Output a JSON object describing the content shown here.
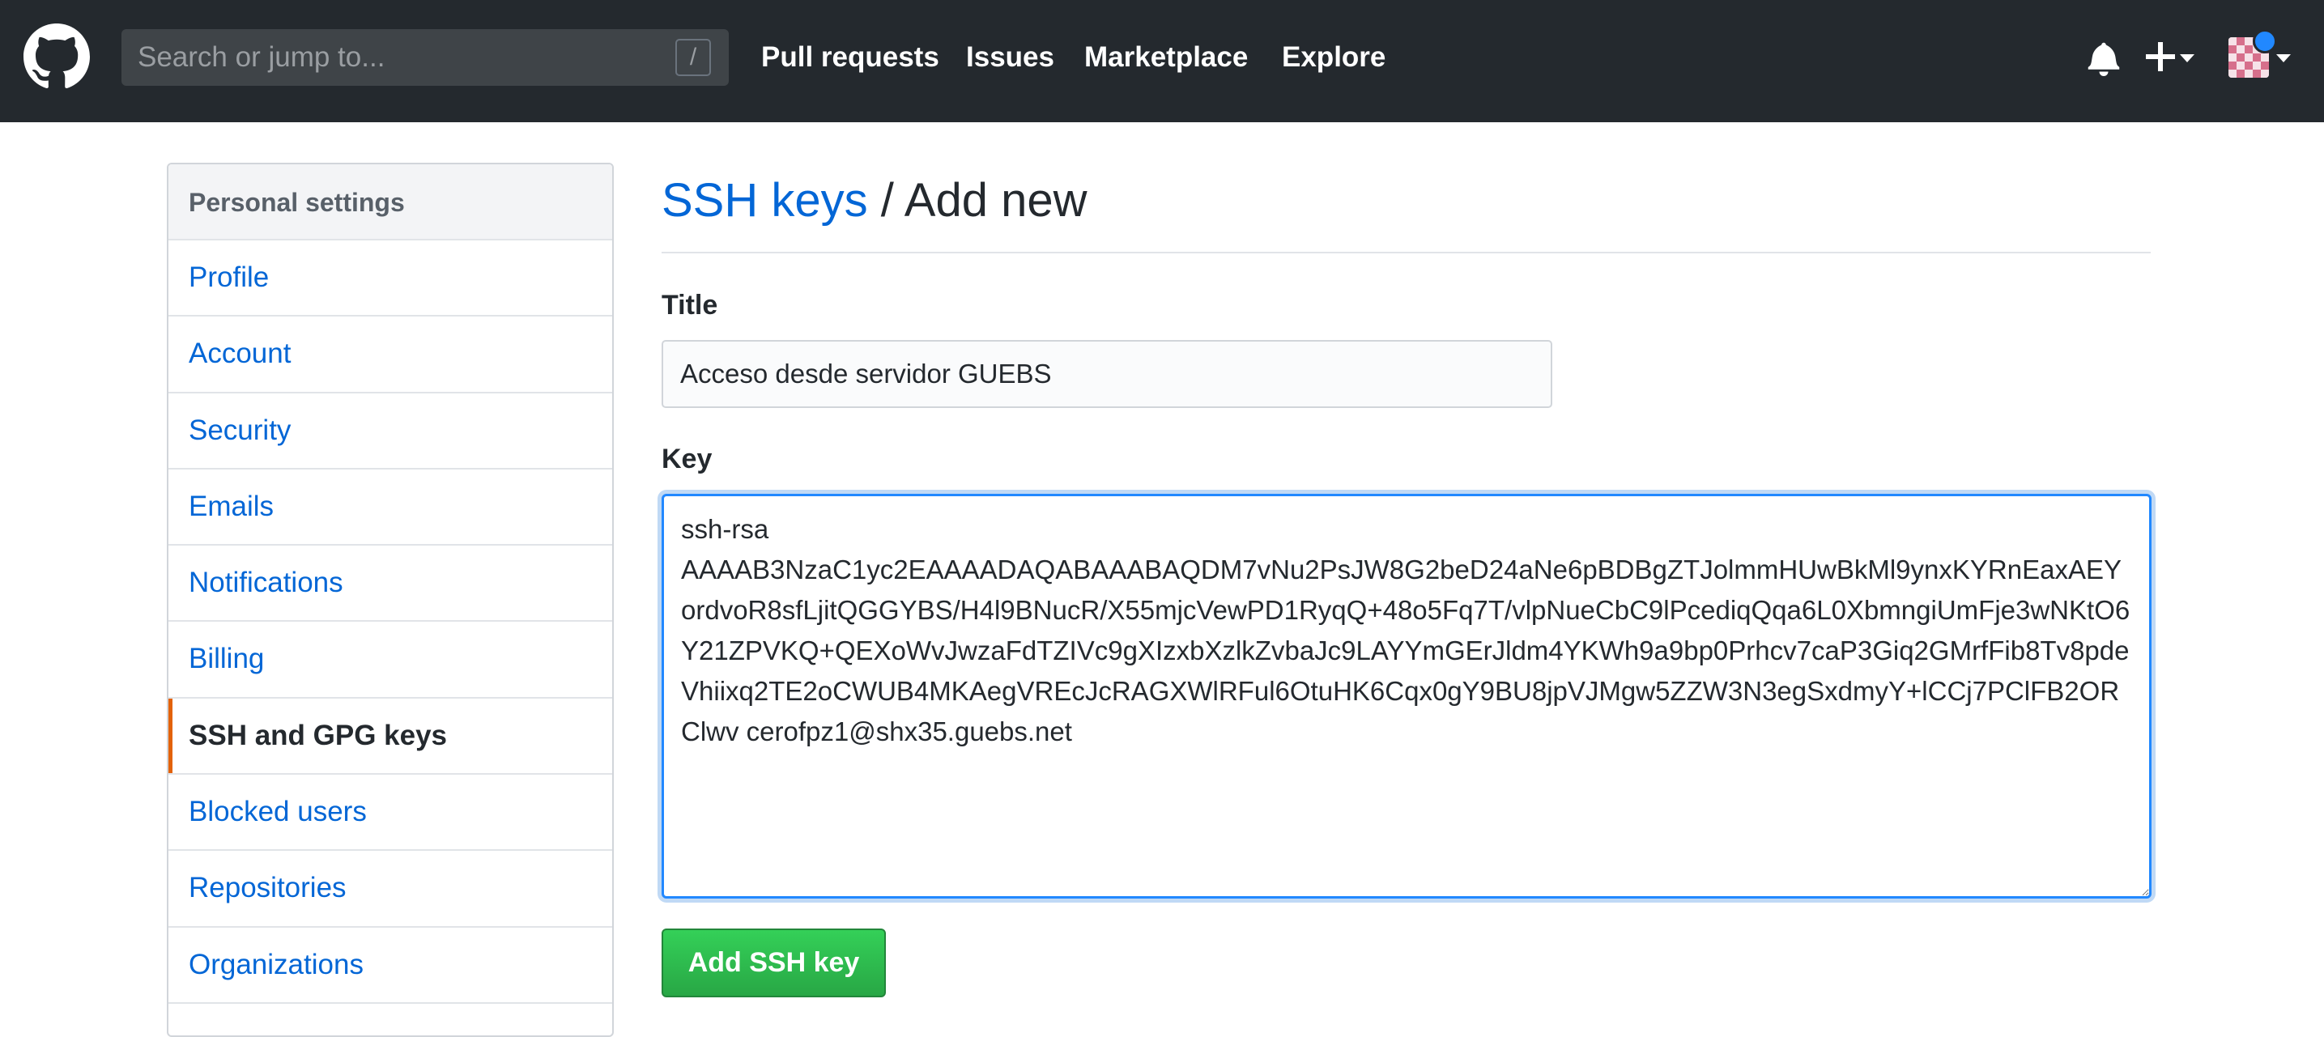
{
  "header": {
    "search_placeholder": "Search or jump to...",
    "search_shortcut": "/",
    "nav": [
      {
        "label": "Pull requests"
      },
      {
        "label": "Issues"
      },
      {
        "label": "Marketplace"
      },
      {
        "label": "Explore"
      }
    ],
    "icons": [
      "github-logo-icon",
      "bell-icon",
      "plus-icon",
      "avatar"
    ]
  },
  "sidebar": {
    "heading": "Personal settings",
    "items": [
      {
        "label": "Profile"
      },
      {
        "label": "Account"
      },
      {
        "label": "Security"
      },
      {
        "label": "Emails"
      },
      {
        "label": "Notifications"
      },
      {
        "label": "Billing"
      },
      {
        "label": "SSH and GPG keys",
        "selected": true
      },
      {
        "label": "Blocked users"
      },
      {
        "label": "Repositories"
      },
      {
        "label": "Organizations"
      }
    ]
  },
  "main": {
    "breadcrumb_link": "SSH keys",
    "breadcrumb_separator": " / ",
    "breadcrumb_current": "Add new",
    "title_label": "Title",
    "title_value": "Acceso desde servidor GUEBS",
    "key_label": "Key",
    "key_value": "ssh-rsa\nAAAAB3NzaC1yc2EAAAADAQABAAABAQDM7vNu2PsJW8G2beD24aNe6pBDBgZTJolmmHUwBkMl9ynxKYRnEaxAEYordvoR8sfLjitQGGYBS/H4l9BNucR/X55mjcVewPD1RyqQ+48o5Fq7T/vlpNueCbC9lPcediqQqa6L0XbmngiUmFje3wNKtO6Y21ZPVKQ+QEXoWvJwzaFdTZIVc9gXIzxbXzlkZvbaJc9LAYYmGErJldm4YKWh9a9bp0Prhcv7caP3Giq2GMrfFib8Tv8pdeVhiixq2TE2oCWUB4MKAegVREcJcRAGXWlRFul6OtuHK6Cqx0gY9BU8jpVJMgw5ZZW3N3egSxdmyY+lCCj7PClFB2ORClwv cerofpz1@shx35.guebs.net",
    "submit_label": "Add SSH key"
  },
  "colors": {
    "header_bg": "#24292e",
    "link": "#0366d6",
    "selected_accent": "#e36209",
    "primary_button": "#28a745",
    "focus_ring": "#2188ff"
  }
}
